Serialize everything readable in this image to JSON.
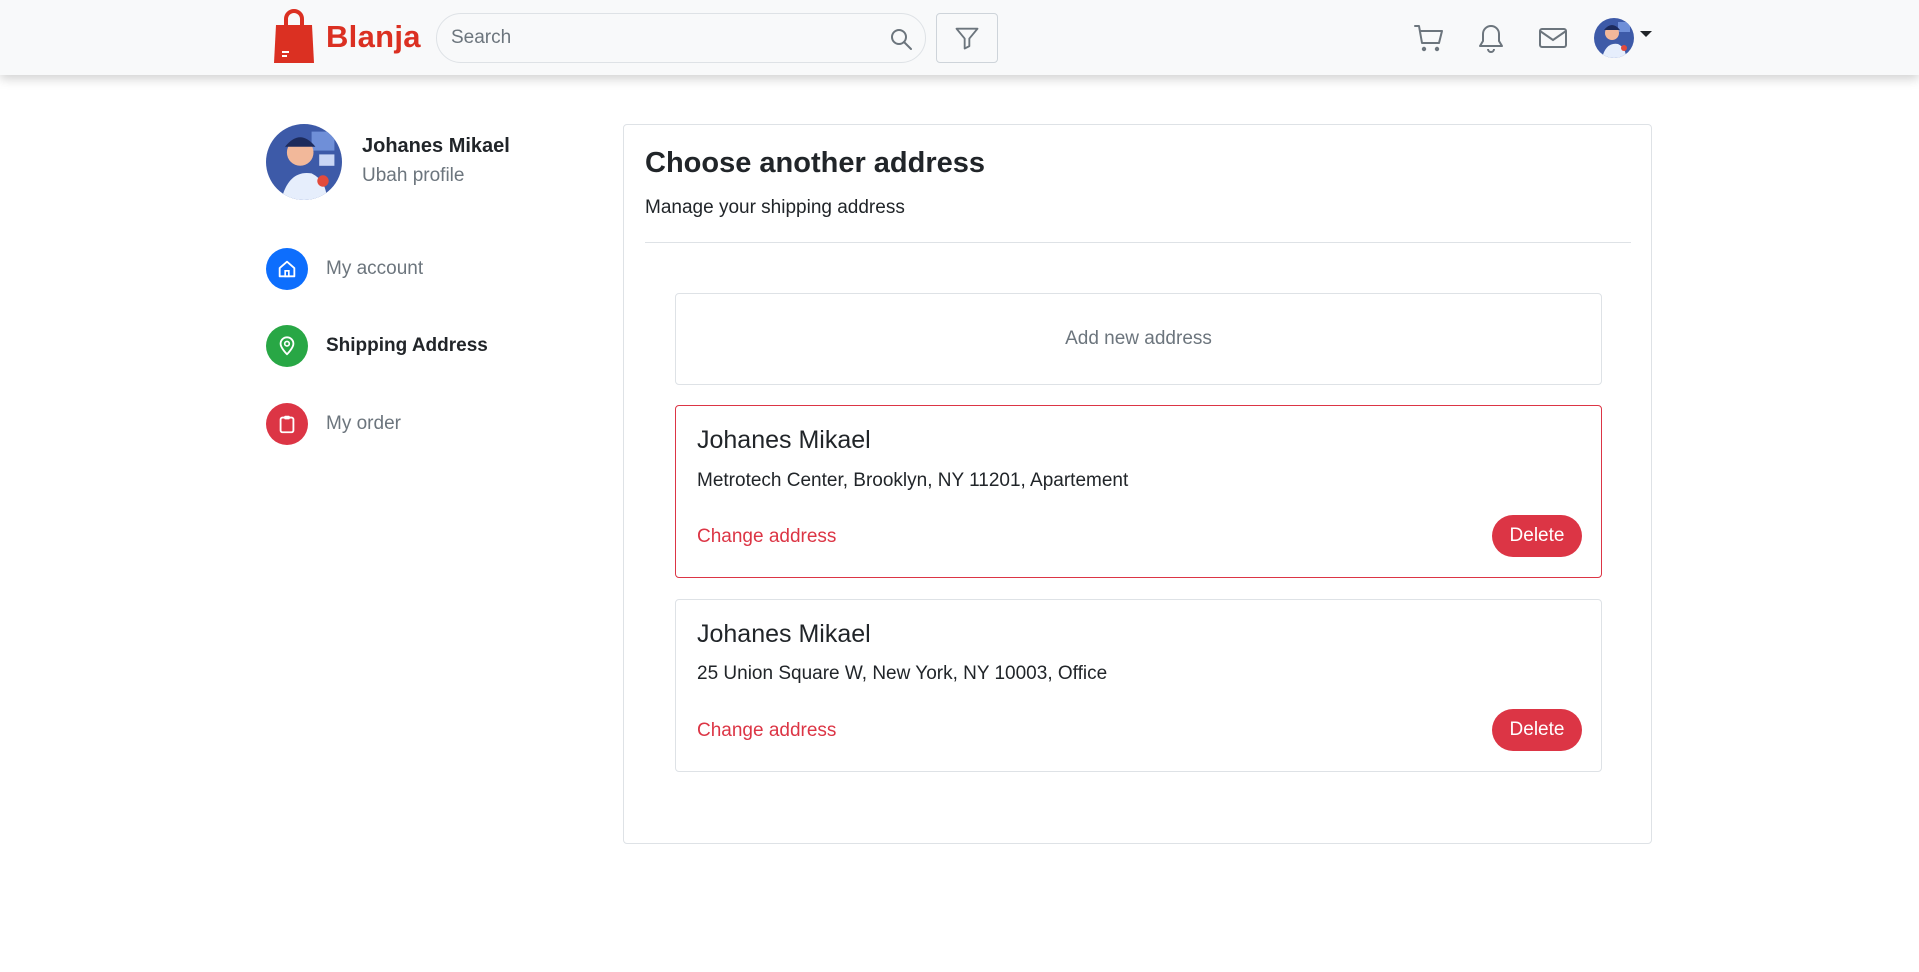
{
  "navbar": {
    "brand": "Blanja",
    "search_placeholder": "Search",
    "icons": [
      "cart-icon",
      "bell-icon",
      "mail-icon"
    ],
    "brand_color": "#db3022"
  },
  "sidebar": {
    "profile": {
      "name": "Johanes Mikael",
      "subtitle": "Ubah profile"
    },
    "items": [
      {
        "label": "My account",
        "icon": "home-icon",
        "color": "#0d6efd",
        "active": false
      },
      {
        "label": "Shipping Address",
        "icon": "map-pin-icon",
        "color": "#28a745",
        "active": true
      },
      {
        "label": "My order",
        "icon": "clipboard-icon",
        "color": "#dc3545",
        "active": false
      }
    ]
  },
  "main": {
    "title": "Choose another address",
    "subtitle": "Manage your shipping address",
    "add_label": "Add new address",
    "addresses": [
      {
        "name": "Johanes Mikael",
        "address": "Metrotech Center, Brooklyn, NY 11201, Apartement",
        "change_label": "Change address",
        "delete_label": "Delete",
        "selected": true
      },
      {
        "name": "Johanes Mikael",
        "address": "25 Union Square W, New York, NY 10003, Office",
        "change_label": "Change address",
        "delete_label": "Delete",
        "selected": false
      }
    ]
  },
  "colors": {
    "danger": "#dc3545",
    "primary": "#0d6efd",
    "success": "#28a745"
  }
}
